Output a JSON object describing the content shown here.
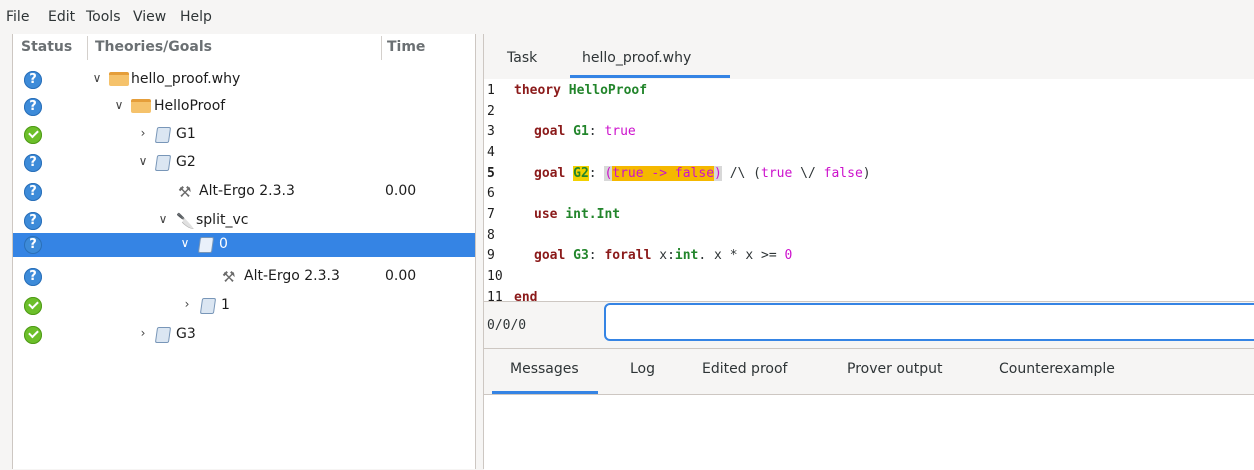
{
  "menubar": {
    "file": "File",
    "edit": "Edit",
    "tools": "Tools",
    "view": "View",
    "help": "Help"
  },
  "tree": {
    "headers": {
      "status": "Status",
      "theories": "Theories/Goals",
      "time": "Time"
    },
    "rows": [
      {
        "label": "hello_proof.why",
        "time": "",
        "status": "unknown",
        "expander": "v",
        "icon": "file-folder-icon"
      },
      {
        "label": "HelloProof",
        "time": "",
        "status": "unknown",
        "expander": "v",
        "icon": "theory-folder-icon"
      },
      {
        "label": "G1",
        "time": "",
        "status": "valid",
        "expander": ">",
        "icon": "goal-scroll-icon"
      },
      {
        "label": "G2",
        "time": "",
        "status": "unknown",
        "expander": "v",
        "icon": "goal-scroll-icon"
      },
      {
        "label": "Alt-Ergo 2.3.3",
        "time": "0.00",
        "status": "unknown",
        "expander": "",
        "icon": "prover-tools-icon"
      },
      {
        "label": "split_vc",
        "time": "",
        "status": "unknown",
        "expander": "v",
        "icon": "transformation-knife-icon"
      },
      {
        "label": "0",
        "time": "",
        "status": "unknown",
        "expander": "v",
        "icon": "goal-scroll-icon",
        "selected": true
      },
      {
        "label": "Alt-Ergo 2.3.3",
        "time": "0.00",
        "status": "unknown",
        "expander": "",
        "icon": "prover-tools-icon"
      },
      {
        "label": "1",
        "time": "",
        "status": "valid",
        "expander": ">",
        "icon": "goal-scroll-icon"
      },
      {
        "label": "G3",
        "time": "",
        "status": "valid",
        "expander": ">",
        "icon": "goal-scroll-icon"
      }
    ]
  },
  "editor_tabs": {
    "task": "Task",
    "file": "hello_proof.why"
  },
  "editor": {
    "line_numbers": [
      "1",
      "2",
      "3",
      "4",
      "5",
      "6",
      "7",
      "8",
      "9",
      "10",
      "11"
    ],
    "l1_kw": "theory",
    "l1_name": "HelloProof",
    "l3_kw": "goal",
    "l3_name": "G1",
    "l3_colon": ":",
    "l3_val": "true",
    "l5_kw": "goal",
    "l5_name": "G2",
    "l5_colon": ":",
    "l5_lpar": "(",
    "l5_true": "true",
    "l5_arrow": " -> ",
    "l5_false": "false",
    "l5_rpar": ")",
    "l5_and": " /\\ (",
    "l5_true2": "true",
    "l5_or": " \\/ ",
    "l5_false2": "false",
    "l5_end": ")",
    "l7_kw": "use",
    "l7_mod": "int.Int",
    "l9_kw": "goal",
    "l9_name": "G3",
    "l9_colon": ":",
    "l9_forall": "forall",
    "l9_x": " x:",
    "l9_int": "int",
    "l9_rest": ". x * x >= ",
    "l9_zero": "0",
    "l11_kw": "end"
  },
  "status": {
    "counter": "0/0/0",
    "command_value": ""
  },
  "bottom_tabs": {
    "messages": "Messages",
    "log": "Log",
    "edited": "Edited proof",
    "prover": "Prover output",
    "counter": "Counterexample"
  },
  "colors": {
    "accent": "#3584e4",
    "valid": "#6cbf2a",
    "unknown": "#3d8bd9",
    "keyword": "#8b1a1a",
    "name": "#22852b",
    "literal": "#cc11cc"
  }
}
